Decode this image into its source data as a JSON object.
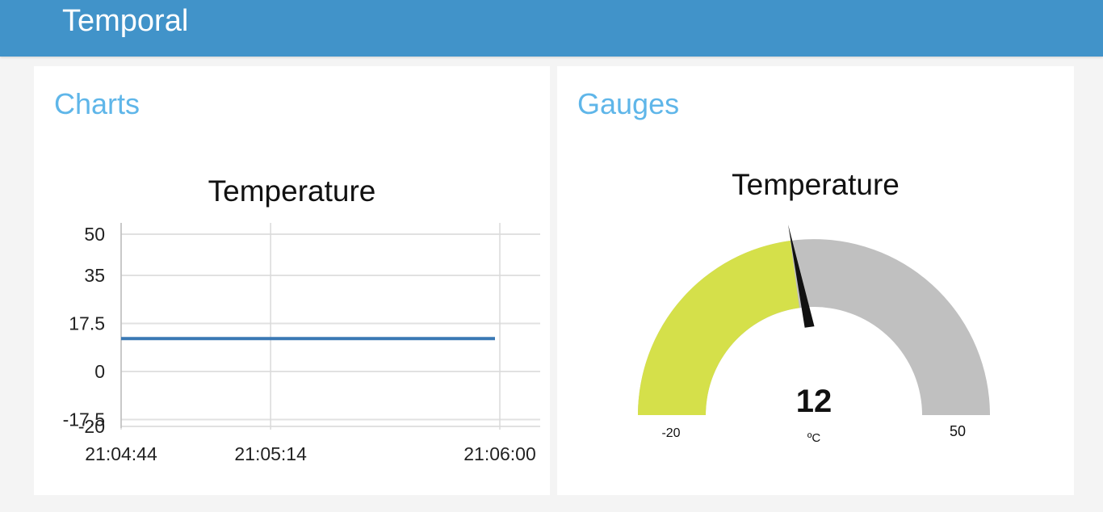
{
  "header": {
    "title": "Temporal"
  },
  "charts_card": {
    "title": "Charts",
    "widget_title": "Temperature"
  },
  "gauges_card": {
    "title": "Gauges",
    "widget_title": "Temperature",
    "gauge": {
      "value": 12,
      "value_label": "12",
      "unit": "ºC",
      "min": -20,
      "max": 50,
      "min_label": "-20",
      "max_label": "50",
      "fill_color": "#d5e04a",
      "track_color": "#c0c0c0",
      "needle_color": "#111111"
    }
  },
  "chart_data": {
    "type": "line",
    "title": "Temperature",
    "xlabel": "",
    "ylabel": "",
    "x_ticks": [
      "21:04:44",
      "21:05:14",
      "21:06:00"
    ],
    "y_ticks": [
      "50",
      "35",
      "17.5",
      "0",
      "-17.5",
      "-20"
    ],
    "ylim": [
      -20,
      50
    ],
    "grid": true,
    "series": [
      {
        "x": [
          "21:04:44",
          "21:06:00"
        ],
        "values": [
          12,
          12
        ],
        "color": "#3a78b4"
      }
    ]
  }
}
